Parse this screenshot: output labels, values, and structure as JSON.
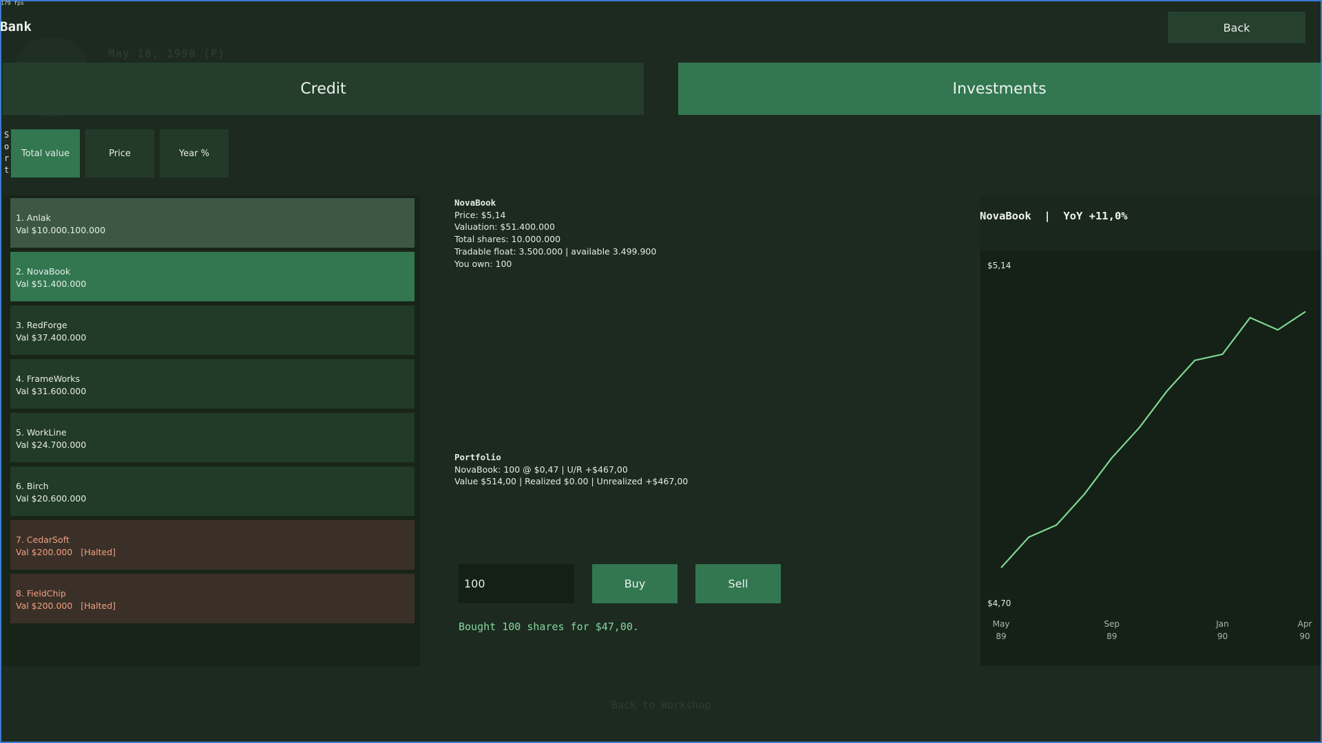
{
  "fps": "179 fps",
  "title": "Bank",
  "ghost_date": "May 16, 1990 (P)",
  "back_label": "Back",
  "tabs": {
    "credit": "Credit",
    "investments": "Investments"
  },
  "sort": {
    "label": "Sort",
    "total_value": "Total value",
    "price": "Price",
    "year_pct": "Year %"
  },
  "companies": [
    {
      "line1": "1. Anlak",
      "line2": "Val $10.000.100.000"
    },
    {
      "line1": "2. NovaBook",
      "line2": "Val $51.400.000"
    },
    {
      "line1": "3. RedForge",
      "line2": "Val $37.400.000"
    },
    {
      "line1": "4. FrameWorks",
      "line2": "Val $31.600.000"
    },
    {
      "line1": "5. WorkLine",
      "line2": "Val $24.700.000"
    },
    {
      "line1": "6. Birch",
      "line2": "Val $20.600.000"
    },
    {
      "line1": "7. CedarSoft",
      "line2": "Val $200.000   [Halted]"
    },
    {
      "line1": "8. FieldChip",
      "line2": "Val $200.000   [Halted]"
    }
  ],
  "detail": {
    "name": "NovaBook",
    "price": "Price: $5,14",
    "valuation": "Valuation: $51.400.000",
    "total_shares": "Total shares: 10.000.000",
    "float": "Tradable float: 3.500.000 | available 3.499.900",
    "own": "You own: 100"
  },
  "portfolio": {
    "header": "Portfolio",
    "line1": "NovaBook: 100 @ $0,47 | U/R +$467,00",
    "line2": "Value $514,00 | Realized $0.00 | Unrealized +$467,00"
  },
  "trade": {
    "qty": "100",
    "buy": "Buy",
    "sell": "Sell",
    "status": "Bought 100 shares for $47,00."
  },
  "chart_title": "NovaBook  |  YoY +11,0%",
  "footer_link": "Back to Workshop",
  "colors": {
    "accent": "#327750",
    "line": "#7fd890",
    "halted": "#f0a080"
  },
  "chart_data": {
    "type": "line",
    "title": "NovaBook  |  YoY +11,0%",
    "ymax_label": "$5,14",
    "ymin_label": "$4,70",
    "ylim": [
      4.7,
      5.14
    ],
    "x_ticks": [
      {
        "top": "May",
        "bottom": "89",
        "index": 0
      },
      {
        "top": "Sep",
        "bottom": "89",
        "index": 4
      },
      {
        "top": "Jan",
        "bottom": "90",
        "index": 8
      },
      {
        "top": "Apr",
        "bottom": "90",
        "index": 11
      }
    ],
    "series": [
      {
        "values": [
          4.71,
          4.76,
          4.78,
          4.83,
          4.89,
          4.94,
          5.0,
          5.05,
          5.06,
          5.12,
          5.1,
          5.13
        ]
      }
    ]
  }
}
